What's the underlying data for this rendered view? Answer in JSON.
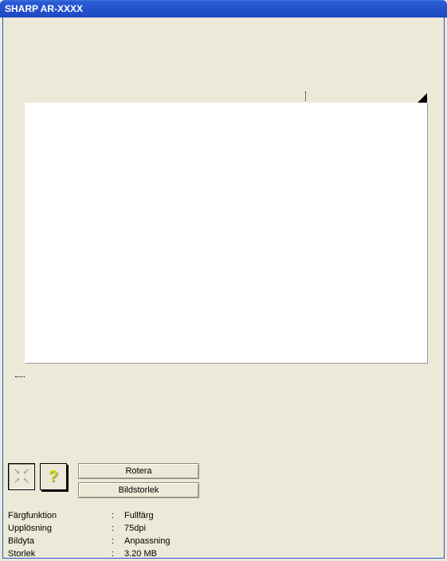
{
  "window": {
    "title": "SHARP AR-XXXX"
  },
  "toolbar": {
    "reset_tooltip": "Reset zoom",
    "help_tooltip": "Help",
    "rotate_label": "Rotera",
    "size_label": "Bildstorlek"
  },
  "info": {
    "rows": [
      {
        "label": "Färgfunktion",
        "value": "Fullfärg"
      },
      {
        "label": "Upplösning",
        "value": "75dpi"
      },
      {
        "label": "Bildyta",
        "value": "Anpassning"
      },
      {
        "label": "Storlek",
        "value": "3.20 MB"
      }
    ],
    "colon": ":"
  }
}
